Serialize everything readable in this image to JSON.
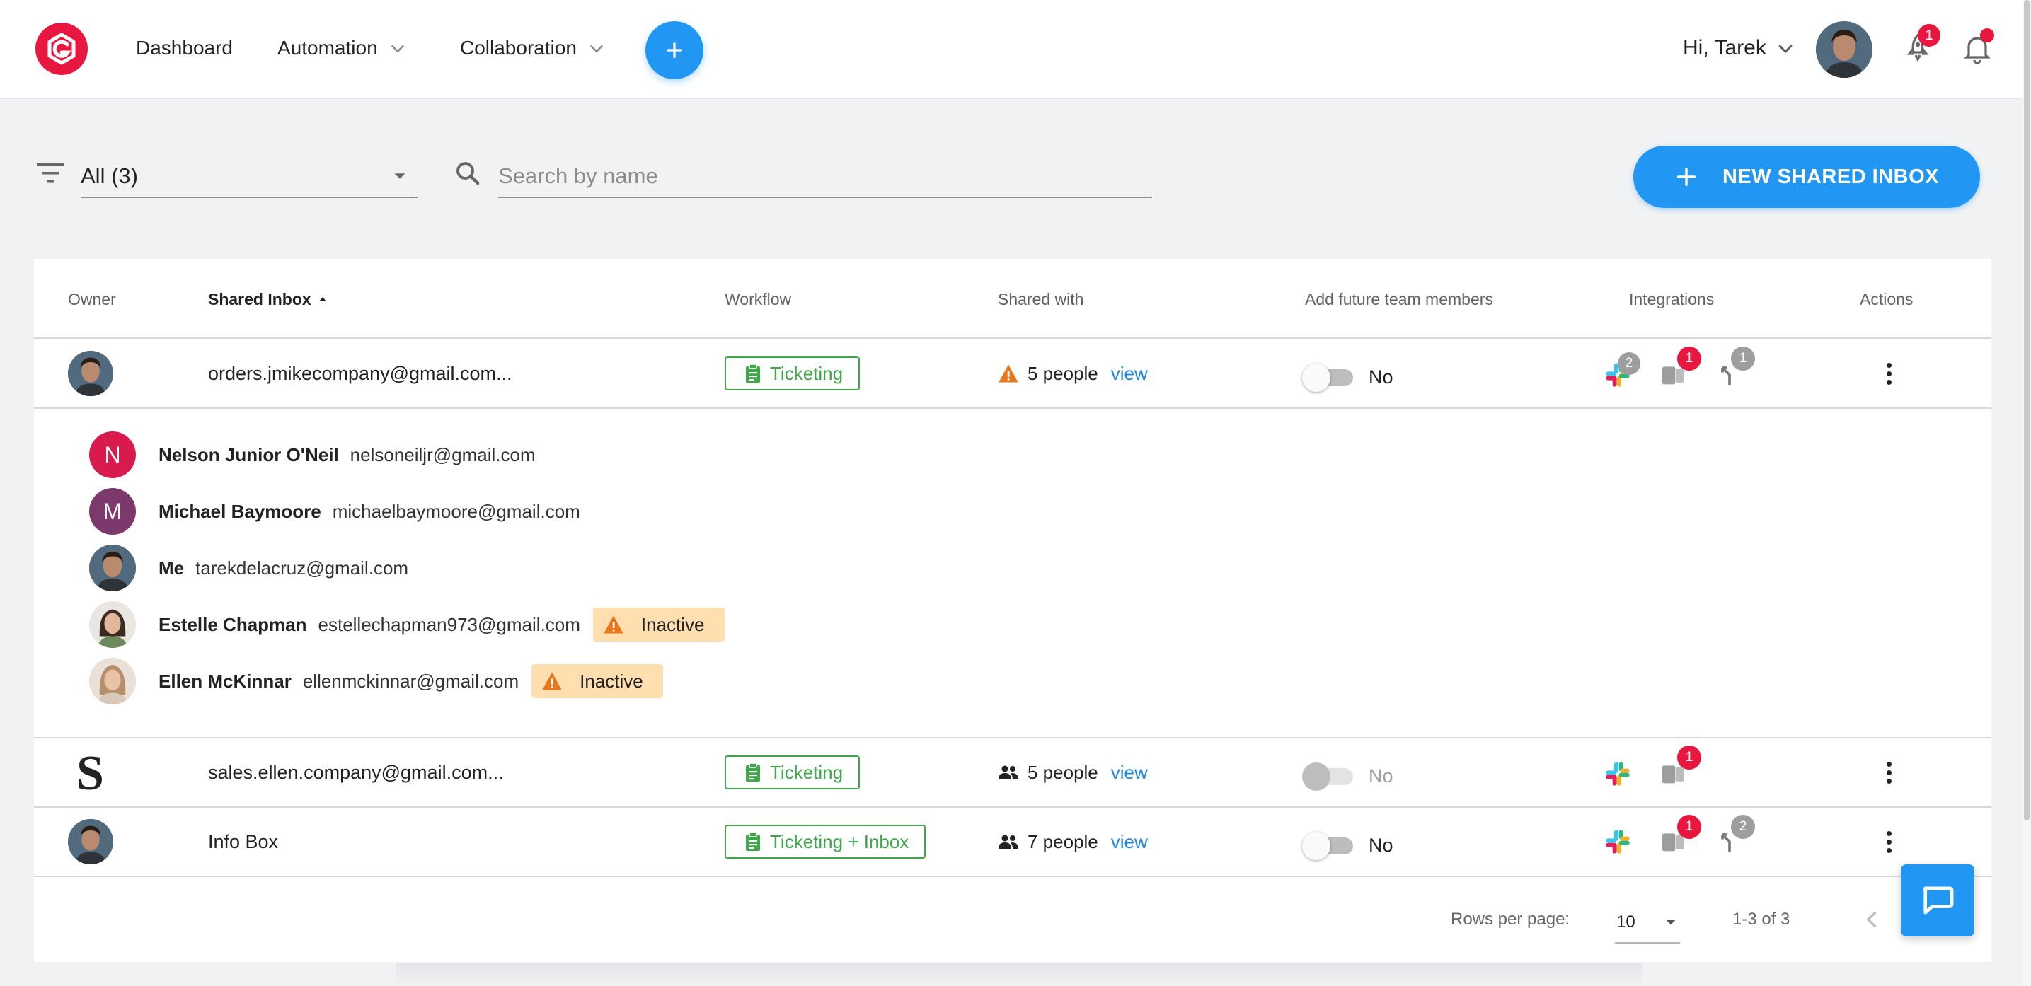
{
  "header": {
    "nav": [
      {
        "label": "Dashboard",
        "has_dropdown": false
      },
      {
        "label": "Automation",
        "has_dropdown": true
      },
      {
        "label": "Collaboration",
        "has_dropdown": true
      }
    ],
    "greeting": "Hi, Tarek",
    "rocket_badge": "1",
    "brand_color": "#e8173f",
    "accent_color": "#2196f3"
  },
  "filter": {
    "selected": "All (3)",
    "search_placeholder": "Search by name",
    "new_button_label": "NEW SHARED INBOX"
  },
  "table": {
    "columns": {
      "owner": "Owner",
      "inbox": "Shared Inbox",
      "workflow": "Workflow",
      "shared_with": "Shared with",
      "future": "Add future team members",
      "integrations": "Integrations",
      "actions": "Actions"
    },
    "rows": [
      {
        "inbox": "orders.jmikecompany@gmail.com...",
        "workflow": "Ticketing",
        "shared_count": "5 people",
        "shared_icon": "warning-icon",
        "view_label": "view",
        "future_label": "No",
        "future_enabled": true,
        "slack_badge": "2",
        "trello_badge": "1",
        "merge_badge": "1"
      },
      {
        "inbox": "sales.ellen.company@gmail.com...",
        "workflow": "Ticketing",
        "shared_count": "5 people",
        "shared_icon": "people-icon",
        "view_label": "view",
        "future_label": "No",
        "future_enabled": false,
        "trello_badge": "1"
      },
      {
        "inbox": "Info Box",
        "workflow": "Ticketing + Inbox",
        "shared_count": "7 people",
        "shared_icon": "people-icon",
        "view_label": "view",
        "future_label": "No",
        "future_enabled": true,
        "trello_badge": "1",
        "merge_badge": "2"
      }
    ],
    "expanded_people": [
      {
        "initial": "N",
        "color": "#d81b4c",
        "name": "Nelson Junior O'Neil",
        "email": "nelsoneiljr@gmail.com",
        "status": ""
      },
      {
        "initial": "M",
        "color": "#7b3a6b",
        "name": "Michael Baymoore",
        "email": "michaelbaymoore@gmail.com",
        "status": ""
      },
      {
        "initial": "",
        "color": "#4a6378",
        "name": "Me",
        "email": "tarekdelacruz@gmail.com",
        "status": ""
      },
      {
        "initial": "",
        "color": "#c9b7a6",
        "name": "Estelle Chapman",
        "email": "estellechapman973@gmail.com",
        "status": "Inactive"
      },
      {
        "initial": "",
        "color": "#bfa892",
        "name": "Ellen McKinnar",
        "email": "ellenmckinnar@gmail.com",
        "status": "Inactive"
      }
    ],
    "footer": {
      "rows_per_page_label": "Rows per page:",
      "rows_per_page": "10",
      "range": "1-3 of 3"
    }
  }
}
